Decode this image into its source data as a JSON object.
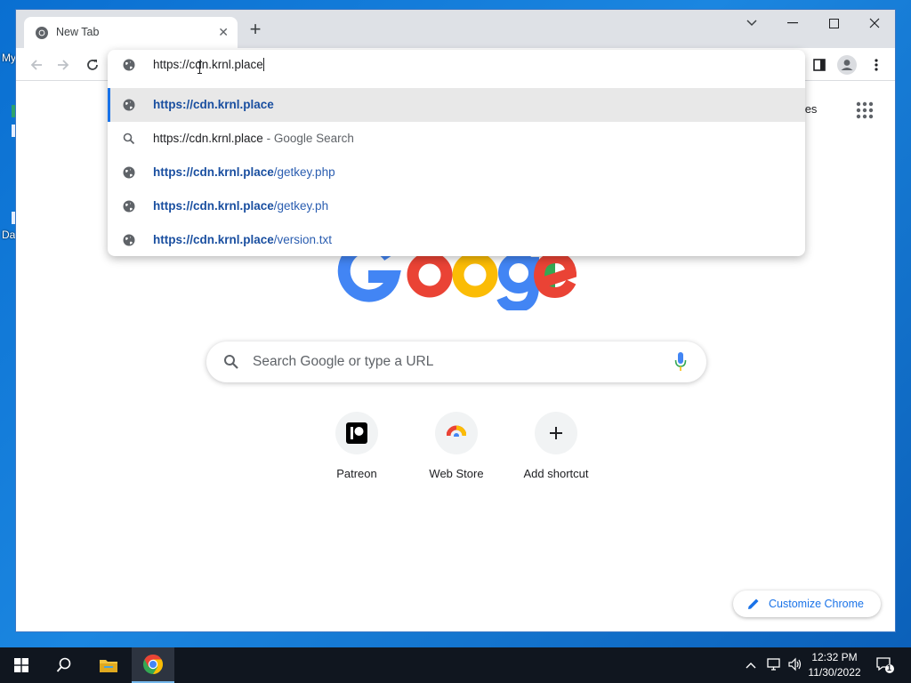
{
  "desktop": {
    "icon_label_1": "My",
    "icon_label_2": "Da"
  },
  "browser": {
    "tab": {
      "title": "New Tab",
      "favicon": "chrome-icon"
    },
    "window_controls": [
      "tab-search-icon",
      "minimize-icon",
      "maximize-icon",
      "close-icon"
    ],
    "toolbar_icons": [
      "back-icon",
      "forward-icon",
      "reload-icon",
      "side-panel-icon",
      "profile-icon",
      "more-menu-icon"
    ],
    "omnibox": {
      "value": "https://cdn.krnl.place",
      "suggestions": [
        {
          "icon": "globe-icon",
          "bold": "https://cdn.krnl.place",
          "rest": "",
          "selected": true
        },
        {
          "icon": "search-icon",
          "plain": "https://cdn.krnl.place",
          "separator": " - ",
          "dim": "Google Search"
        },
        {
          "icon": "globe-icon",
          "bold": "https://cdn.krnl.place",
          "rest": "/getkey.php"
        },
        {
          "icon": "globe-icon",
          "bold": "https://cdn.krnl.place",
          "rest": "/getkey.ph"
        },
        {
          "icon": "globe-icon",
          "bold": "https://cdn.krnl.place",
          "rest": "/version.txt"
        }
      ]
    }
  },
  "newtab": {
    "images_link": "nages",
    "search_placeholder": "Search Google or type a URL",
    "shortcuts": [
      {
        "label": "Patreon",
        "icon": "patreon-icon"
      },
      {
        "label": "Web Store",
        "icon": "web-store-icon"
      },
      {
        "label": "Add shortcut",
        "icon": "plus-icon"
      }
    ],
    "customize_label": "Customize Chrome"
  },
  "taskbar": {
    "time": "12:32 PM",
    "date": "11/30/2022",
    "notification_count": "1"
  },
  "colors": {
    "accent": "#1a73e8",
    "google_blue": "#4285f4",
    "google_red": "#ea4335",
    "google_yellow": "#fbbc05",
    "google_green": "#34a853"
  }
}
